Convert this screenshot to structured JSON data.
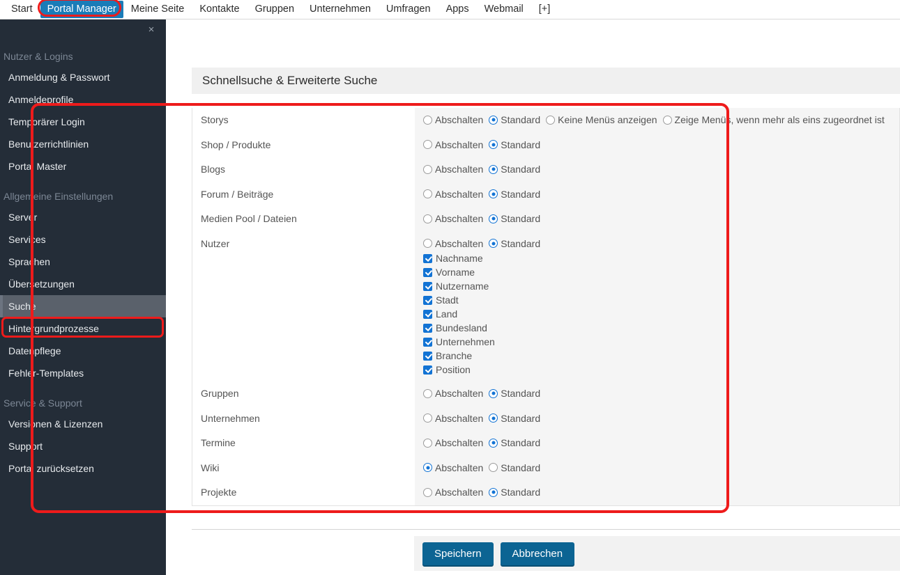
{
  "topnav": {
    "items": [
      {
        "label": "Start",
        "active": false
      },
      {
        "label": "Portal Manager",
        "active": true
      },
      {
        "label": "Meine Seite",
        "active": false
      },
      {
        "label": "Kontakte",
        "active": false
      },
      {
        "label": "Gruppen",
        "active": false
      },
      {
        "label": "Unternehmen",
        "active": false
      },
      {
        "label": "Umfragen",
        "active": false
      },
      {
        "label": "Apps",
        "active": false
      },
      {
        "label": "Webmail",
        "active": false
      },
      {
        "label": "[+]",
        "active": false
      }
    ]
  },
  "sidebar": {
    "close_label": "×",
    "groups": [
      {
        "title": "Nutzer & Logins",
        "items": [
          {
            "label": "Anmeldung & Passwort",
            "selected": false
          },
          {
            "label": "Anmeldeprofile",
            "selected": false
          },
          {
            "label": "Temporärer Login",
            "selected": false
          },
          {
            "label": "Benutzerrichtlinien",
            "selected": false
          },
          {
            "label": "Portal Master",
            "selected": false
          }
        ]
      },
      {
        "title": "Allgemeine Einstellungen",
        "items": [
          {
            "label": "Server",
            "selected": false
          },
          {
            "label": "Services",
            "selected": false
          },
          {
            "label": "Sprachen",
            "selected": false
          },
          {
            "label": "Übersetzungen",
            "selected": false
          },
          {
            "label": "Suche",
            "selected": true
          },
          {
            "label": "Hintergrundprozesse",
            "selected": false
          },
          {
            "label": "Datenpflege",
            "selected": false
          },
          {
            "label": "Fehler-Templates",
            "selected": false
          }
        ]
      },
      {
        "title": "Service & Support",
        "items": [
          {
            "label": "Versionen & Lizenzen",
            "selected": false
          },
          {
            "label": "Support",
            "selected": false
          },
          {
            "label": "Portal zurücksetzen",
            "selected": false
          }
        ]
      }
    ]
  },
  "panel": {
    "title": "Schnellsuche & Erweiterte Suche",
    "rows": [
      {
        "label": "Storys",
        "options": [
          {
            "label": "Abschalten",
            "selected": false
          },
          {
            "label": "Standard",
            "selected": true
          },
          {
            "label": "Keine Menüs anzeigen",
            "selected": false
          },
          {
            "label": "Zeige Menüs, wenn mehr als eins zugeordnet ist",
            "selected": false
          }
        ],
        "checkboxes": []
      },
      {
        "label": "Shop / Produkte",
        "options": [
          {
            "label": "Abschalten",
            "selected": false
          },
          {
            "label": "Standard",
            "selected": true
          }
        ],
        "checkboxes": []
      },
      {
        "label": "Blogs",
        "options": [
          {
            "label": "Abschalten",
            "selected": false
          },
          {
            "label": "Standard",
            "selected": true
          }
        ],
        "checkboxes": []
      },
      {
        "label": "Forum / Beiträge",
        "options": [
          {
            "label": "Abschalten",
            "selected": false
          },
          {
            "label": "Standard",
            "selected": true
          }
        ],
        "checkboxes": []
      },
      {
        "label": "Medien Pool / Dateien",
        "options": [
          {
            "label": "Abschalten",
            "selected": false
          },
          {
            "label": "Standard",
            "selected": true
          }
        ],
        "checkboxes": []
      },
      {
        "label": "Nutzer",
        "options": [
          {
            "label": "Abschalten",
            "selected": false
          },
          {
            "label": "Standard",
            "selected": true
          }
        ],
        "checkboxes": [
          {
            "label": "Nachname",
            "checked": true
          },
          {
            "label": "Vorname",
            "checked": true
          },
          {
            "label": "Nutzername",
            "checked": true
          },
          {
            "label": "Stadt",
            "checked": true
          },
          {
            "label": "Land",
            "checked": true
          },
          {
            "label": "Bundesland",
            "checked": true
          },
          {
            "label": "Unternehmen",
            "checked": true
          },
          {
            "label": "Branche",
            "checked": true
          },
          {
            "label": "Position",
            "checked": true
          }
        ]
      },
      {
        "label": "Gruppen",
        "options": [
          {
            "label": "Abschalten",
            "selected": false
          },
          {
            "label": "Standard",
            "selected": true
          }
        ],
        "checkboxes": []
      },
      {
        "label": "Unternehmen",
        "options": [
          {
            "label": "Abschalten",
            "selected": false
          },
          {
            "label": "Standard",
            "selected": true
          }
        ],
        "checkboxes": []
      },
      {
        "label": "Termine",
        "options": [
          {
            "label": "Abschalten",
            "selected": false
          },
          {
            "label": "Standard",
            "selected": true
          }
        ],
        "checkboxes": []
      },
      {
        "label": "Wiki",
        "options": [
          {
            "label": "Abschalten",
            "selected": true
          },
          {
            "label": "Standard",
            "selected": false
          }
        ],
        "checkboxes": []
      },
      {
        "label": "Projekte",
        "options": [
          {
            "label": "Abschalten",
            "selected": false
          },
          {
            "label": "Standard",
            "selected": true
          }
        ],
        "checkboxes": []
      }
    ]
  },
  "footer": {
    "save_label": "Speichern",
    "cancel_label": "Abbrechen"
  },
  "colors": {
    "accent_blue": "#1273d4",
    "nav_active": "#1a7cb8",
    "button": "#0c6493",
    "sidebar_bg": "#242d38",
    "annotation_red": "#ee1b1b"
  }
}
